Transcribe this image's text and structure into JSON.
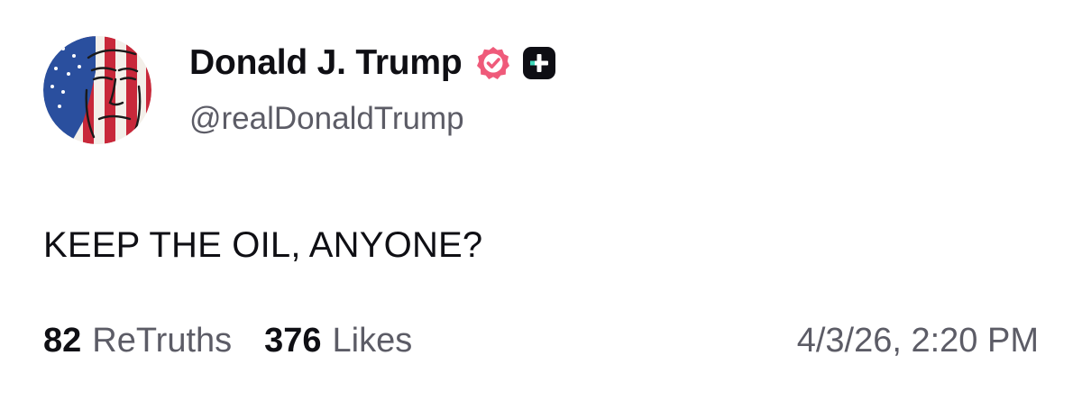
{
  "author": {
    "display_name": "Donald J. Trump",
    "handle": "@realDonaldTrump",
    "avatar_icon": "flag-portrait-avatar",
    "verified_icon": "verified-badge-icon",
    "verified_color": "#ef5a7a",
    "subscription_icon": "truth-plus-icon"
  },
  "post": {
    "text": "KEEP THE OIL, ANYONE?"
  },
  "stats": {
    "retruths_count": "82",
    "retruths_label": "ReTruths",
    "likes_count": "376",
    "likes_label": "Likes",
    "timestamp": "4/3/26, 2:20 PM"
  }
}
